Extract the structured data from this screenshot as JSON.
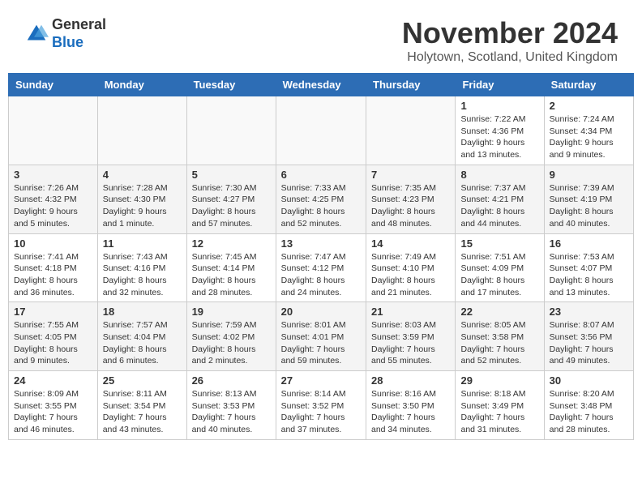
{
  "header": {
    "logo_general": "General",
    "logo_blue": "Blue",
    "title": "November 2024",
    "location": "Holytown, Scotland, United Kingdom"
  },
  "columns": [
    "Sunday",
    "Monday",
    "Tuesday",
    "Wednesday",
    "Thursday",
    "Friday",
    "Saturday"
  ],
  "weeks": [
    [
      {
        "day": "",
        "info": ""
      },
      {
        "day": "",
        "info": ""
      },
      {
        "day": "",
        "info": ""
      },
      {
        "day": "",
        "info": ""
      },
      {
        "day": "",
        "info": ""
      },
      {
        "day": "1",
        "info": "Sunrise: 7:22 AM\nSunset: 4:36 PM\nDaylight: 9 hours and 13 minutes."
      },
      {
        "day": "2",
        "info": "Sunrise: 7:24 AM\nSunset: 4:34 PM\nDaylight: 9 hours and 9 minutes."
      }
    ],
    [
      {
        "day": "3",
        "info": "Sunrise: 7:26 AM\nSunset: 4:32 PM\nDaylight: 9 hours and 5 minutes."
      },
      {
        "day": "4",
        "info": "Sunrise: 7:28 AM\nSunset: 4:30 PM\nDaylight: 9 hours and 1 minute."
      },
      {
        "day": "5",
        "info": "Sunrise: 7:30 AM\nSunset: 4:27 PM\nDaylight: 8 hours and 57 minutes."
      },
      {
        "day": "6",
        "info": "Sunrise: 7:33 AM\nSunset: 4:25 PM\nDaylight: 8 hours and 52 minutes."
      },
      {
        "day": "7",
        "info": "Sunrise: 7:35 AM\nSunset: 4:23 PM\nDaylight: 8 hours and 48 minutes."
      },
      {
        "day": "8",
        "info": "Sunrise: 7:37 AM\nSunset: 4:21 PM\nDaylight: 8 hours and 44 minutes."
      },
      {
        "day": "9",
        "info": "Sunrise: 7:39 AM\nSunset: 4:19 PM\nDaylight: 8 hours and 40 minutes."
      }
    ],
    [
      {
        "day": "10",
        "info": "Sunrise: 7:41 AM\nSunset: 4:18 PM\nDaylight: 8 hours and 36 minutes."
      },
      {
        "day": "11",
        "info": "Sunrise: 7:43 AM\nSunset: 4:16 PM\nDaylight: 8 hours and 32 minutes."
      },
      {
        "day": "12",
        "info": "Sunrise: 7:45 AM\nSunset: 4:14 PM\nDaylight: 8 hours and 28 minutes."
      },
      {
        "day": "13",
        "info": "Sunrise: 7:47 AM\nSunset: 4:12 PM\nDaylight: 8 hours and 24 minutes."
      },
      {
        "day": "14",
        "info": "Sunrise: 7:49 AM\nSunset: 4:10 PM\nDaylight: 8 hours and 21 minutes."
      },
      {
        "day": "15",
        "info": "Sunrise: 7:51 AM\nSunset: 4:09 PM\nDaylight: 8 hours and 17 minutes."
      },
      {
        "day": "16",
        "info": "Sunrise: 7:53 AM\nSunset: 4:07 PM\nDaylight: 8 hours and 13 minutes."
      }
    ],
    [
      {
        "day": "17",
        "info": "Sunrise: 7:55 AM\nSunset: 4:05 PM\nDaylight: 8 hours and 9 minutes."
      },
      {
        "day": "18",
        "info": "Sunrise: 7:57 AM\nSunset: 4:04 PM\nDaylight: 8 hours and 6 minutes."
      },
      {
        "day": "19",
        "info": "Sunrise: 7:59 AM\nSunset: 4:02 PM\nDaylight: 8 hours and 2 minutes."
      },
      {
        "day": "20",
        "info": "Sunrise: 8:01 AM\nSunset: 4:01 PM\nDaylight: 7 hours and 59 minutes."
      },
      {
        "day": "21",
        "info": "Sunrise: 8:03 AM\nSunset: 3:59 PM\nDaylight: 7 hours and 55 minutes."
      },
      {
        "day": "22",
        "info": "Sunrise: 8:05 AM\nSunset: 3:58 PM\nDaylight: 7 hours and 52 minutes."
      },
      {
        "day": "23",
        "info": "Sunrise: 8:07 AM\nSunset: 3:56 PM\nDaylight: 7 hours and 49 minutes."
      }
    ],
    [
      {
        "day": "24",
        "info": "Sunrise: 8:09 AM\nSunset: 3:55 PM\nDaylight: 7 hours and 46 minutes."
      },
      {
        "day": "25",
        "info": "Sunrise: 8:11 AM\nSunset: 3:54 PM\nDaylight: 7 hours and 43 minutes."
      },
      {
        "day": "26",
        "info": "Sunrise: 8:13 AM\nSunset: 3:53 PM\nDaylight: 7 hours and 40 minutes."
      },
      {
        "day": "27",
        "info": "Sunrise: 8:14 AM\nSunset: 3:52 PM\nDaylight: 7 hours and 37 minutes."
      },
      {
        "day": "28",
        "info": "Sunrise: 8:16 AM\nSunset: 3:50 PM\nDaylight: 7 hours and 34 minutes."
      },
      {
        "day": "29",
        "info": "Sunrise: 8:18 AM\nSunset: 3:49 PM\nDaylight: 7 hours and 31 minutes."
      },
      {
        "day": "30",
        "info": "Sunrise: 8:20 AM\nSunset: 3:48 PM\nDaylight: 7 hours and 28 minutes."
      }
    ]
  ]
}
